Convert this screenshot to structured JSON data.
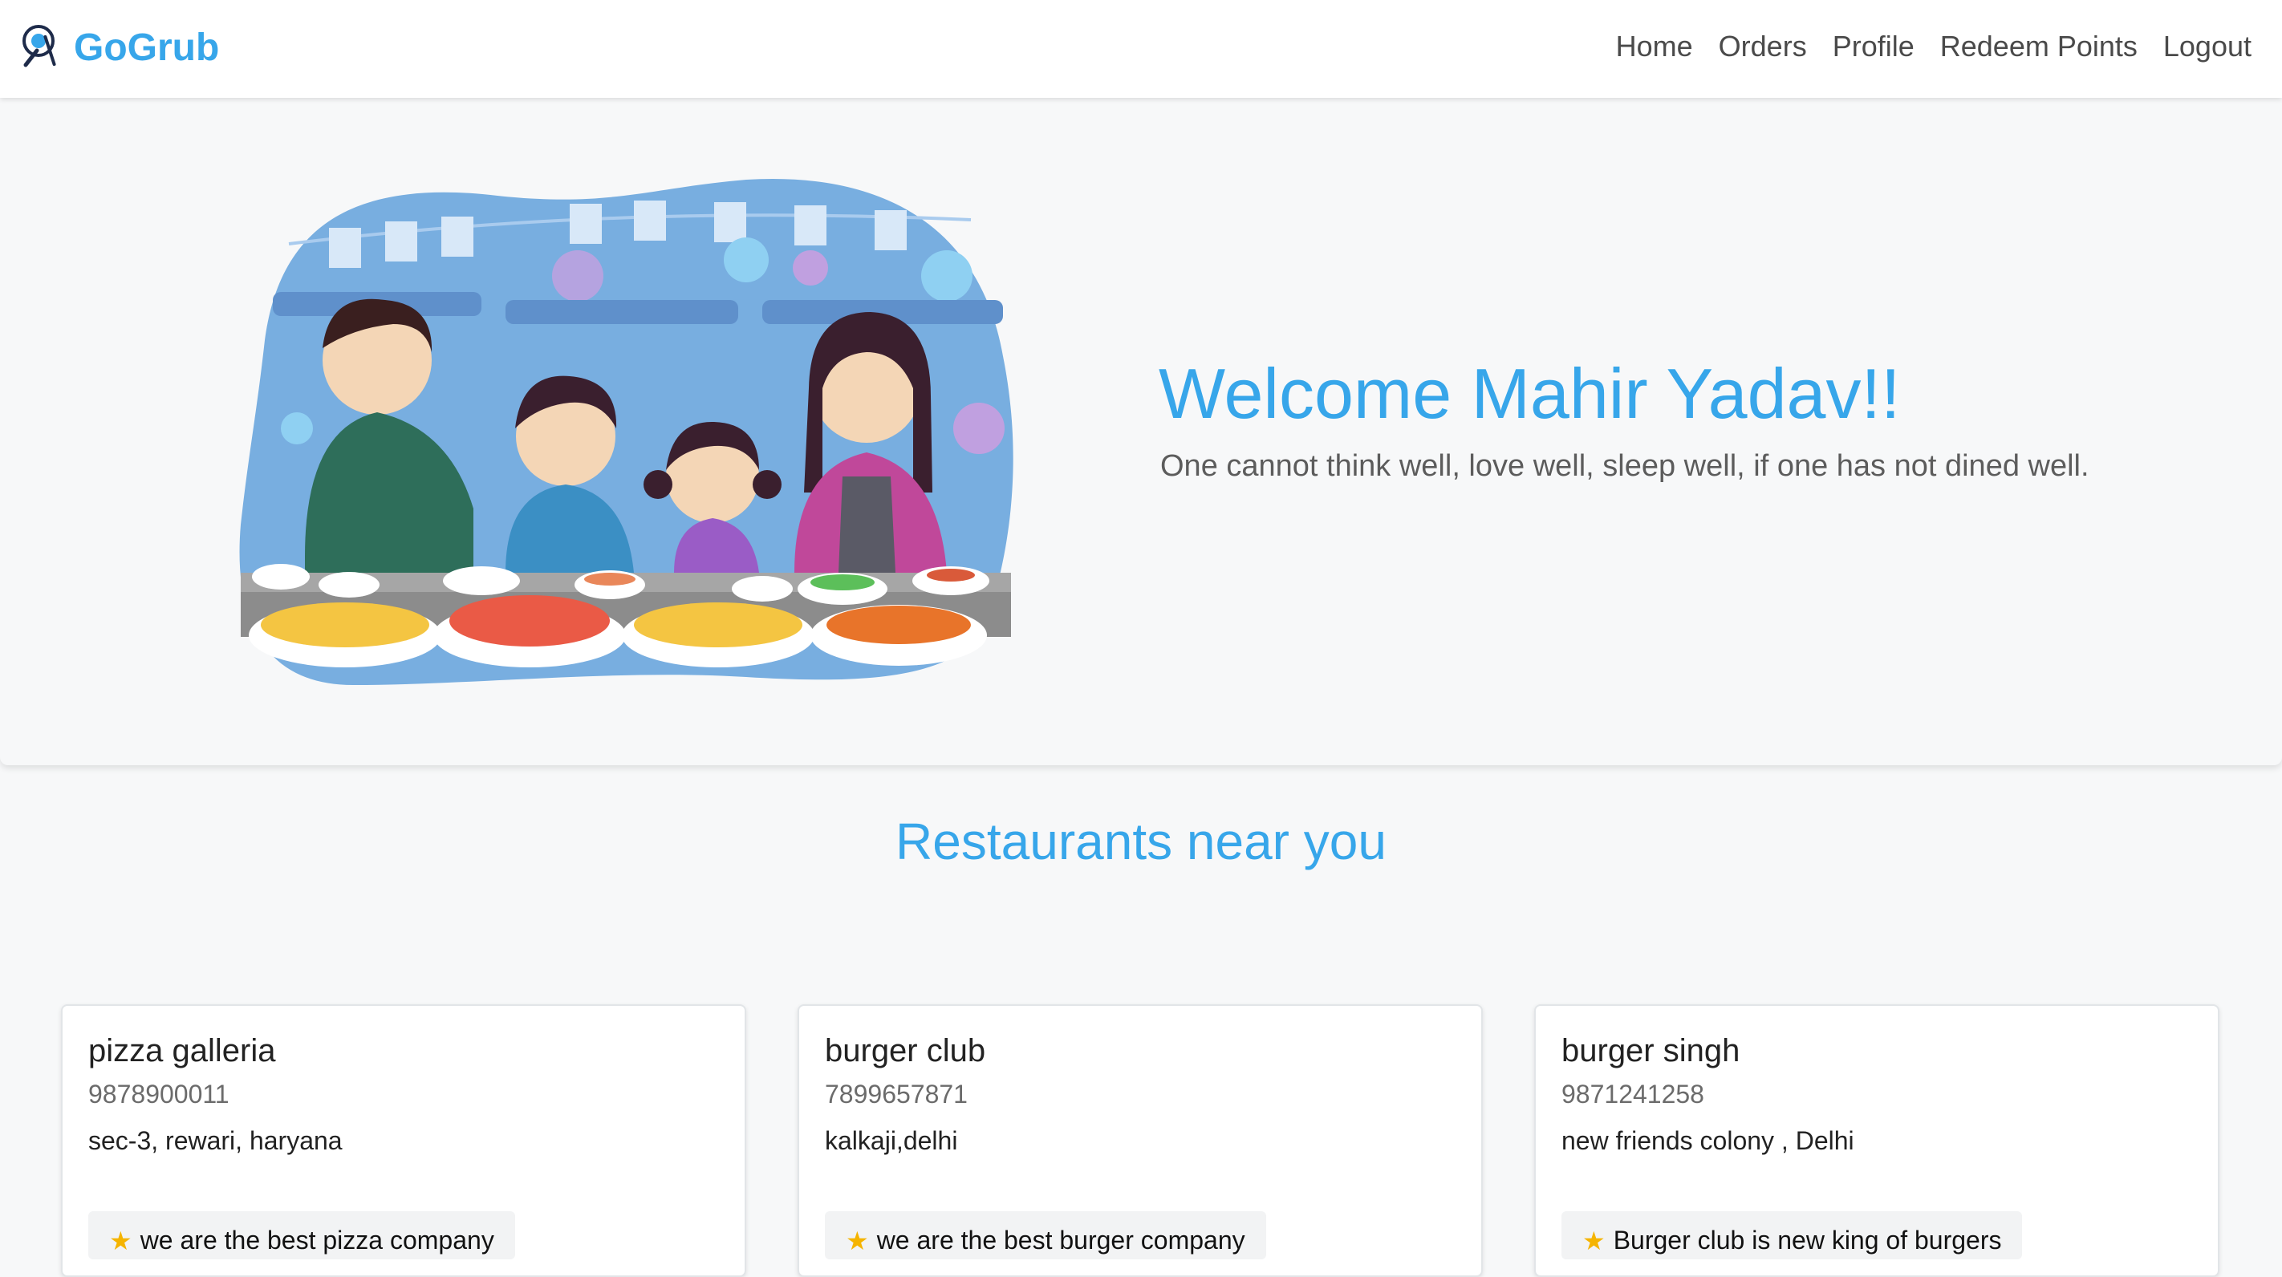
{
  "navbar": {
    "brand": "GoGrub",
    "links": [
      "Home",
      "Orders",
      "Profile",
      "Redeem Points",
      "Logout"
    ]
  },
  "hero": {
    "title": "Welcome Mahir Yadav!!",
    "subtitle": "One cannot think well, love well, sleep well, if one has not dined well."
  },
  "restaurants_section": {
    "title": "Restaurants near you",
    "items": [
      {
        "name": "pizza galleria",
        "phone": "9878900011",
        "address": "sec-3, rewari, haryana",
        "tagline": "we are the best pizza company"
      },
      {
        "name": "burger club",
        "phone": "7899657871",
        "address": "kalkaji,delhi",
        "tagline": "we are the best burger company"
      },
      {
        "name": "burger singh",
        "phone": "9871241258",
        "address": "new friends colony , Delhi",
        "tagline": "Burger club is new king of burgers"
      }
    ]
  },
  "colors": {
    "accent": "#37a6ea",
    "background": "#f7f8f9",
    "star": "#f5b400"
  },
  "icons": {
    "brand_logo": "fork-spoon-plate-icon",
    "tagline_icon": "star-icon"
  }
}
